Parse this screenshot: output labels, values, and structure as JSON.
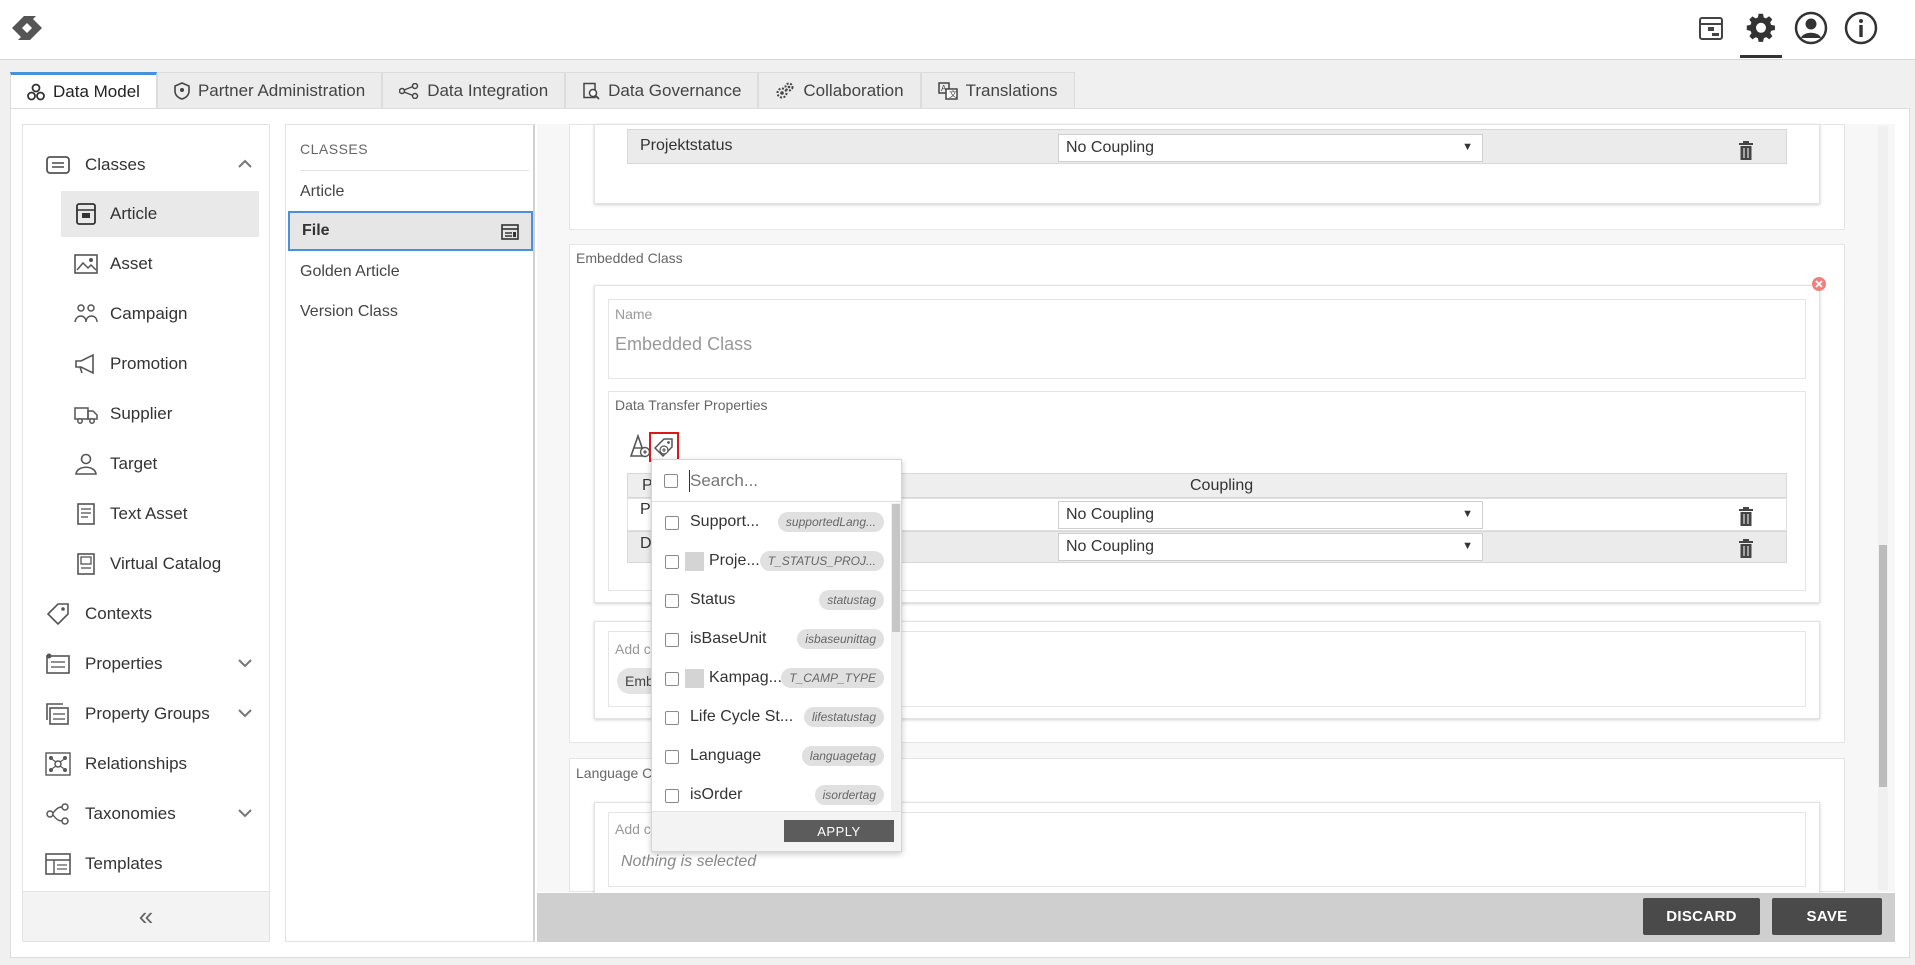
{
  "tabs": [
    {
      "label": "Data Model",
      "icon": "data-model-icon"
    },
    {
      "label": "Partner Administration",
      "icon": "shield-icon"
    },
    {
      "label": "Data Integration",
      "icon": "integration-icon"
    },
    {
      "label": "Data Governance",
      "icon": "governance-icon"
    },
    {
      "label": "Collaboration",
      "icon": "gears-icon"
    },
    {
      "label": "Translations",
      "icon": "translate-icon"
    }
  ],
  "sidebar": {
    "items": [
      {
        "label": "Classes"
      },
      {
        "label": "Article"
      },
      {
        "label": "Asset"
      },
      {
        "label": "Campaign"
      },
      {
        "label": "Promotion"
      },
      {
        "label": "Supplier"
      },
      {
        "label": "Target"
      },
      {
        "label": "Text Asset"
      },
      {
        "label": "Virtual Catalog"
      },
      {
        "label": "Contexts"
      },
      {
        "label": "Properties"
      },
      {
        "label": "Property Groups"
      },
      {
        "label": "Relationships"
      },
      {
        "label": "Taxonomies"
      },
      {
        "label": "Templates"
      }
    ],
    "collapse_glyph": "«"
  },
  "classes": {
    "heading": "CLASSES",
    "items": [
      "Article",
      "File",
      "Golden Article",
      "Version Class"
    ]
  },
  "content": {
    "top_row_label": "Projektstatus",
    "coupling_value": "No Coupling",
    "embedded_title": "Embedded Class",
    "name_label": "Name",
    "name_value": "Embedded Class",
    "dtp_title": "Data Transfer Properties",
    "col_p": "P",
    "col_coupling": "Coupling",
    "row1_initial": "P",
    "row2_initial": "D",
    "add_label": "Add c",
    "chip": "Emb",
    "language_title": "Language C",
    "add_label2": "Add c",
    "nothing_selected": "Nothing is selected"
  },
  "dropdown": {
    "placeholder": "Search...",
    "items": [
      {
        "name": "Support...",
        "tag": "supportedLang..."
      },
      {
        "name": "Proje...",
        "tag": "T_STATUS_PROJ..."
      },
      {
        "name": "Status",
        "tag": "statustag"
      },
      {
        "name": "isBaseUnit",
        "tag": "isbaseunittag"
      },
      {
        "name": "Kampag...",
        "tag": "T_CAMP_TYPE"
      },
      {
        "name": "Life Cycle St...",
        "tag": "lifestatustag"
      },
      {
        "name": "Language",
        "tag": "languagetag"
      },
      {
        "name": "isOrder",
        "tag": "isordertag"
      }
    ],
    "apply": "APPLY"
  },
  "buttons": {
    "discard": "DISCARD",
    "save": "SAVE"
  },
  "colors": {
    "accent": "#4a90d9",
    "highlight_red": "#e0161b",
    "close_red": "#f08080"
  }
}
